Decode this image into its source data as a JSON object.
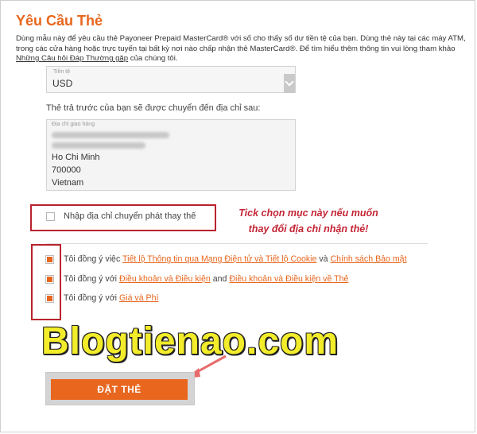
{
  "page": {
    "title": "Yêu Cầu Thẻ",
    "intro_text": "Dùng mẫu này để yêu cầu thẻ Payoneer Prepaid MasterCard® với số cho thấy số dư tiền tệ của bạn. Dùng thẻ này tại các máy ATM, trong các cửa hàng hoặc trực tuyến tại bất kỳ nơi nào chấp nhận thẻ MasterCard®. Để tìm hiểu thêm thông tin vui lòng tham khảo",
    "intro_link": "Những Câu hỏi Đáp Thường gặp",
    "intro_tail": "của chúng tôi."
  },
  "currency": {
    "label": "Tiền tệ",
    "value": "USD"
  },
  "address": {
    "notice": "Thẻ trả trước của bạn sẽ được chuyển đến địa chỉ sau:",
    "label": "Địa chỉ giao hàng",
    "city": "Ho Chi Minh",
    "postal": "700000",
    "country": "Vietnam"
  },
  "alternate_address": {
    "label": "Nhập địa chỉ chuyển phát thay thế",
    "checked": false
  },
  "annotation": {
    "line1": "Tick chọn mục này nếu muốn",
    "line2": "thay đổi địa chỉ nhận thẻ!"
  },
  "agreements": [
    {
      "prefix": "Tôi đồng ý việc",
      "link1": "Tiết lộ Thông tin qua Mạng Điện tử và Tiết lộ Cookie",
      "mid": "và",
      "link2": "Chính sách Bảo mật",
      "checked": true
    },
    {
      "prefix": "Tôi đồng ý với",
      "link1": "Điều khoản và Điều kiện",
      "mid": "and",
      "link2": "Điều khoản và Điều kiện về Thẻ",
      "checked": true
    },
    {
      "prefix": "Tôi đồng ý với",
      "link1": "Giá và Phí",
      "checked": true
    }
  ],
  "watermark": "Blogtienao.com",
  "submit_label": "ĐẶT THẺ",
  "colors": {
    "accent": "#e8661d",
    "annotation_red": "#c42535",
    "highlight_box": "#b9232e",
    "watermark_yellow": "#f2ec2a"
  }
}
